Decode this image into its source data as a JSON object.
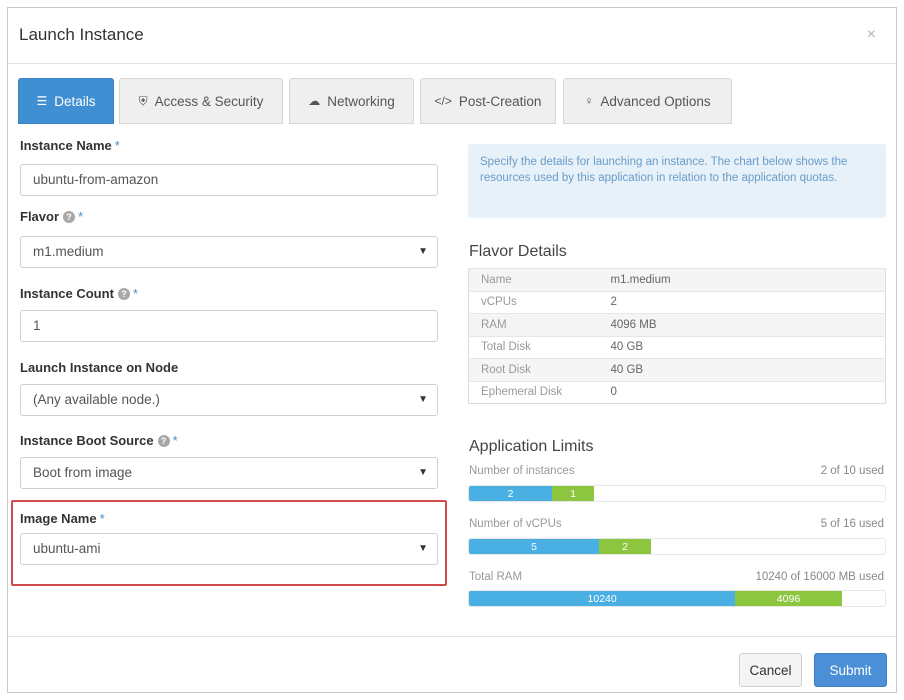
{
  "modal": {
    "title": "Launch Instance",
    "close_glyph": "×"
  },
  "tabs": [
    {
      "label": "Details",
      "icon": "list-icon",
      "glyph": "☰",
      "active": true
    },
    {
      "label": "Access & Security",
      "icon": "shield-icon",
      "glyph": "⛨"
    },
    {
      "label": "Networking",
      "icon": "cloud-icon",
      "glyph": "☁"
    },
    {
      "label": "Post-Creation",
      "icon": "code-icon",
      "glyph": "</>"
    },
    {
      "label": "Advanced Options",
      "icon": "lightbulb-icon",
      "glyph": "♀"
    }
  ],
  "form": {
    "instance_name": {
      "label": "Instance Name",
      "required": "*",
      "value": "ubuntu-from-amazon"
    },
    "flavor": {
      "label": "Flavor",
      "required": "*",
      "value": "m1.medium"
    },
    "instance_count": {
      "label": "Instance Count",
      "required": "*",
      "value": "1"
    },
    "launch_on_node": {
      "label": "Launch Instance on Node",
      "value": "(Any available node.)"
    },
    "boot_source": {
      "label": "Instance Boot Source",
      "required": "*",
      "value": "Boot from image"
    },
    "image_name": {
      "label": "Image Name",
      "required": "*",
      "value": "ubuntu-ami"
    }
  },
  "info_text": "Specify the details for launching an instance. The chart below shows the resources used by this application in relation to the application quotas.",
  "flavor_details": {
    "title": "Flavor Details",
    "rows": [
      {
        "key": "Name",
        "value": "m1.medium"
      },
      {
        "key": "vCPUs",
        "value": "2"
      },
      {
        "key": "RAM",
        "value": "4096 MB"
      },
      {
        "key": "Total Disk",
        "value": "40 GB"
      },
      {
        "key": "Root Disk",
        "value": "40 GB"
      },
      {
        "key": "Ephemeral Disk",
        "value": "0"
      }
    ]
  },
  "application_limits": {
    "title": "Application Limits",
    "items": [
      {
        "label": "Number of instances",
        "used_text": "2 of 10 used",
        "current": 2,
        "added": 1,
        "total": 10,
        "current_label": "2",
        "added_label": "1"
      },
      {
        "label": "Number of vCPUs",
        "used_text": "5 of 16 used",
        "current": 5,
        "added": 2,
        "total": 16,
        "current_label": "5",
        "added_label": "2"
      },
      {
        "label": "Total RAM",
        "used_text": "10240 of 16000 MB used",
        "current": 10240,
        "added": 4096,
        "total": 16000,
        "current_label": "10240",
        "added_label": "4096"
      }
    ]
  },
  "footer": {
    "cancel_label": "Cancel",
    "submit_label": "Submit"
  },
  "colors": {
    "primary": "#3f8fd2",
    "current_bar": "#4ab0e3",
    "added_bar": "#8cc63f",
    "highlight": "#d24a4a"
  }
}
